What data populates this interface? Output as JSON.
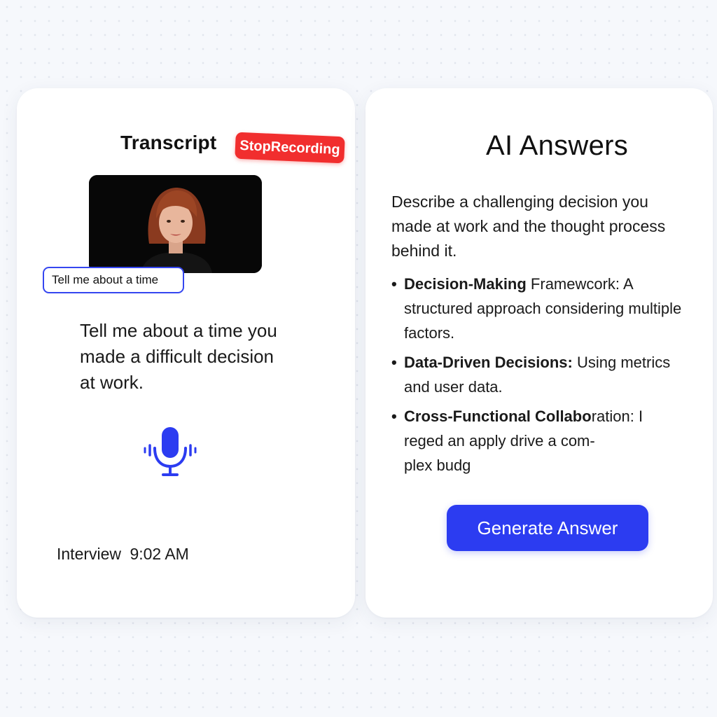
{
  "transcript": {
    "title": "Transcript",
    "stop_button_label": "StopRecording",
    "caption_chip": "Tell me about a time",
    "question": "Tell me about a time you made a difficult decision at work.",
    "footer_label": "Interview",
    "footer_time": "9:02 AM",
    "mic_color": "#2c3cf1"
  },
  "answers": {
    "title": "AI Answers",
    "prompt": "Describe a challenging decision you made at work and the thought process behind it.",
    "bullets": [
      {
        "heading": "Decision-Making",
        "rest": " Framewcork: A structured approach considering multiple factors."
      },
      {
        "heading": "Data-Driven Decisions:",
        "rest": " Using metrics and user data."
      },
      {
        "heading": "Cross-Functional Collabo",
        "rest_line1": "ration: I",
        "rest_line2": "reged an apply drive a com-",
        "rest_line3": "plex budg"
      }
    ],
    "generate_button_label": "Generate Answer"
  },
  "colors": {
    "accent": "#2c3cf1",
    "stop_red": "#f12e2e",
    "background": "#f6f8fc"
  }
}
